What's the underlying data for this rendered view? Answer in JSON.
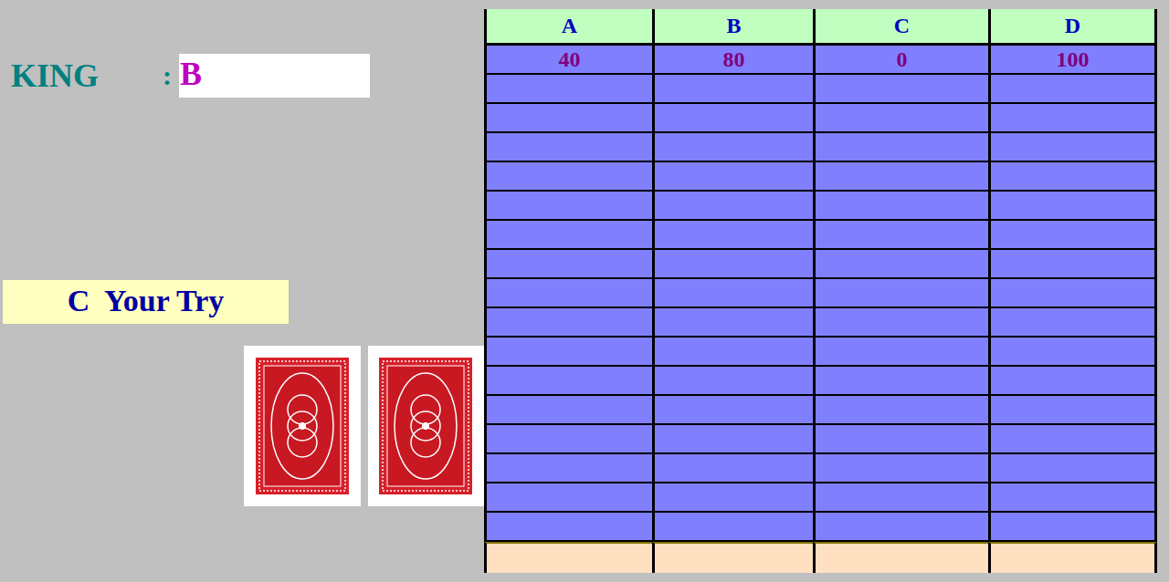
{
  "player": {
    "label": "KING",
    "separator": ":",
    "value": "B"
  },
  "turn": {
    "label": "C  Your Try"
  },
  "cards": [
    {
      "face_down": true
    },
    {
      "face_down": true
    }
  ],
  "table": {
    "columns": [
      "A",
      "B",
      "C",
      "D"
    ],
    "rows": [
      [
        "40",
        "80",
        "0",
        "100"
      ],
      [
        "",
        "",
        "",
        ""
      ],
      [
        "",
        "",
        "",
        ""
      ],
      [
        "",
        "",
        "",
        ""
      ],
      [
        "",
        "",
        "",
        ""
      ],
      [
        "",
        "",
        "",
        ""
      ],
      [
        "",
        "",
        "",
        ""
      ],
      [
        "",
        "",
        "",
        ""
      ],
      [
        "",
        "",
        "",
        ""
      ],
      [
        "",
        "",
        "",
        ""
      ],
      [
        "",
        "",
        "",
        ""
      ],
      [
        "",
        "",
        "",
        ""
      ],
      [
        "",
        "",
        "",
        ""
      ],
      [
        "",
        "",
        "",
        ""
      ],
      [
        "",
        "",
        "",
        ""
      ],
      [
        "",
        "",
        "",
        ""
      ],
      [
        "",
        "",
        "",
        ""
      ]
    ],
    "footer": [
      "",
      "",
      "",
      ""
    ]
  }
}
